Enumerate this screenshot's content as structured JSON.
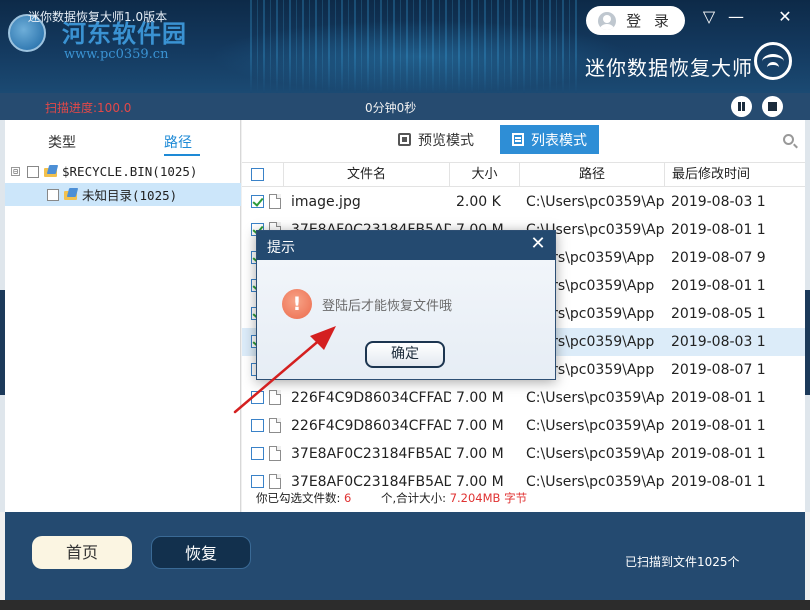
{
  "window": {
    "title": "迷你数据恢复大师1.0版本",
    "watermark_name": "河东软件园",
    "watermark_url": "www.pc0359.cn",
    "login_label": "登 录",
    "app_name": "迷你数据恢复大师",
    "menu_glyph": "▽",
    "minimize_glyph": "—",
    "close_glyph": "✕"
  },
  "scan": {
    "progress_text": "扫描进度:100.0",
    "elapsed_text": "0分钟0秒"
  },
  "left": {
    "tabs": [
      {
        "label": "类型",
        "active": false
      },
      {
        "label": "路径",
        "active": true
      }
    ],
    "tree": [
      {
        "label": "$RECYCLE.BIN(1025)",
        "expander": "⊟",
        "selected": false
      },
      {
        "label": "未知目录(1025)",
        "selected": true
      }
    ]
  },
  "right": {
    "modes": [
      {
        "label": "预览模式",
        "active": false
      },
      {
        "label": "列表模式",
        "active": true
      }
    ],
    "columns": [
      "文件名",
      "大小",
      "路径",
      "最后修改时间"
    ],
    "rows": [
      {
        "checked": true,
        "name": "image.jpg",
        "size": "2.00 K",
        "path": "C:\\Users\\pc0359\\App",
        "date": "2019-08-03 1"
      },
      {
        "checked": true,
        "name": "37E8AF0C23184FB5ADA",
        "size": "7.00 M",
        "path": "C:\\Users\\pc0359\\App",
        "date": "2019-08-01 1"
      },
      {
        "checked": true,
        "name": "",
        "size": "",
        "path": "Users\\pc0359\\App",
        "date": "2019-08-07 9"
      },
      {
        "checked": true,
        "name": "",
        "size": "",
        "path": "Users\\pc0359\\App",
        "date": "2019-08-01 1"
      },
      {
        "checked": true,
        "name": "",
        "size": "",
        "path": "Users\\pc0359\\App",
        "date": "2019-08-05 1"
      },
      {
        "checked": true,
        "name": "",
        "size": "",
        "path": "Users\\pc0359\\App",
        "date": "2019-08-03 1",
        "highlight": true
      },
      {
        "checked": false,
        "name": "",
        "size": "",
        "path": "Users\\pc0359\\App",
        "date": "2019-08-07 1"
      },
      {
        "checked": false,
        "name": "226F4C9D86034CFFAD9",
        "size": "7.00 M",
        "path": "C:\\Users\\pc0359\\App",
        "date": "2019-08-01 1"
      },
      {
        "checked": false,
        "name": "226F4C9D86034CFFAD9",
        "size": "7.00 M",
        "path": "C:\\Users\\pc0359\\App",
        "date": "2019-08-01 1"
      },
      {
        "checked": false,
        "name": "37E8AF0C23184FB5ADA",
        "size": "7.00 M",
        "path": "C:\\Users\\pc0359\\App",
        "date": "2019-08-01 1"
      },
      {
        "checked": false,
        "name": "37E8AF0C23184FB5ADA",
        "size": "7.00 M",
        "path": "C:\\Users\\pc0359\\App",
        "date": "2019-08-01 1"
      }
    ],
    "footer": {
      "selected_label": "你已勾选文件数:",
      "selected_count": "6",
      "total_label": "个,合计大小:",
      "total_size": "7.204MB 字节"
    }
  },
  "bottom": {
    "home_label": "首页",
    "recover_label": "恢复",
    "scanned_text": "已扫描到文件1025个"
  },
  "dialog": {
    "title": "提示",
    "close_glyph": "✕",
    "icon_glyph": "!",
    "message": "登陆后才能恢复文件哦",
    "ok_label": "确定"
  },
  "colors": {
    "header": "#143a60",
    "accent": "#2e8ed6",
    "alert": "#e03232",
    "arrow": "#d42020"
  }
}
